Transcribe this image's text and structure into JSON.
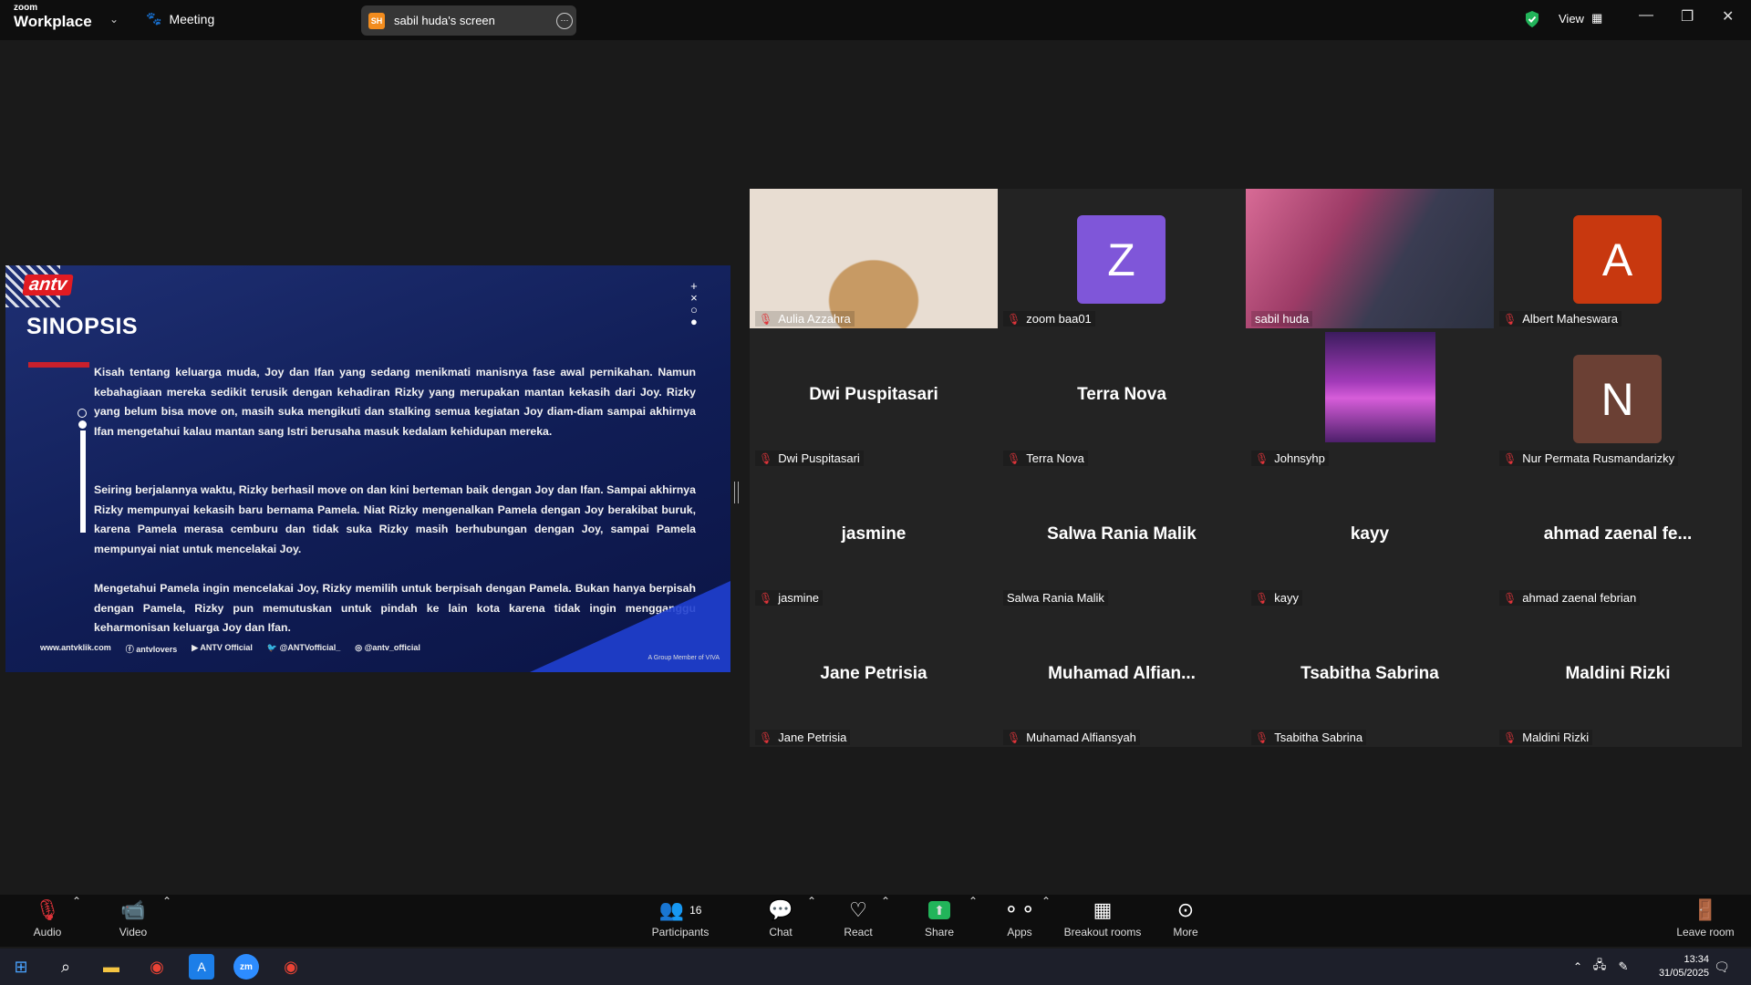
{
  "app": {
    "logo_top": "zoom",
    "logo_bottom": "Workplace",
    "meeting_label": "Meeting",
    "screen_badge": "SH",
    "screen_title": "sabil huda's screen",
    "view_label": "View"
  },
  "shared_screen": {
    "brand": "antv",
    "heading": "SINOPSIS",
    "paragraphs": [
      "Kisah tentang keluarga muda, Joy dan Ifan yang sedang menikmati manisnya fase awal pernikahan. Namun kebahagiaan mereka sedikit terusik dengan kehadiran Rizky yang merupakan mantan kekasih dari Joy. Rizky yang belum bisa move on, masih suka mengikuti dan stalking semua kegiatan Joy diam-diam sampai akhirnya Ifan mengetahui kalau mantan sang Istri berusaha masuk kedalam kehidupan mereka.",
      "Seiring berjalannya waktu, Rizky berhasil move on dan kini berteman baik dengan Joy dan Ifan. Sampai akhirnya Rizky mempunyai kekasih baru bernama Pamela. Niat Rizky mengenalkan Pamela dengan Joy berakibat buruk, karena Pamela merasa cemburu dan tidak suka Rizky masih berhubungan dengan Joy, sampai Pamela mempunyai niat untuk mencelakai Joy.",
      "Mengetahui Pamela ingin mencelakai Joy, Rizky memilih untuk berpisah dengan Pamela. Bukan hanya berpisah dengan Pamela, Rizky pun memutuskan untuk pindah ke lain kota karena tidak ingin mengganggu keharmonisan keluarga Joy dan Ifan."
    ],
    "footer": {
      "website": "www.antvklik.com",
      "facebook": "antvlovers",
      "youtube": "ANTV Official",
      "twitter": "@ANTVofficial_",
      "instagram": "@antv_official"
    },
    "group_text": "A Group Member of VIVA"
  },
  "participants": [
    {
      "tile_name": "Aulia Azzahra",
      "center": "",
      "avatar": "",
      "avatar_color": "",
      "kind": "photo1",
      "muted": true
    },
    {
      "tile_name": "zoom baa01",
      "center": "",
      "avatar": "Z",
      "avatar_color": "#7f56d9",
      "kind": "avatar",
      "muted": true
    },
    {
      "tile_name": "sabil huda",
      "center": "",
      "avatar": "",
      "avatar_color": "",
      "kind": "photo3",
      "muted": false,
      "active": true
    },
    {
      "tile_name": "Albert Maheswara",
      "center": "",
      "avatar": "A",
      "avatar_color": "#c8380f",
      "kind": "avatar",
      "muted": true
    },
    {
      "tile_name": "Dwi Puspitasari",
      "center": "Dwi Puspitasari",
      "avatar": "",
      "avatar_color": "",
      "kind": "text",
      "muted": true
    },
    {
      "tile_name": "Terra Nova",
      "center": "Terra Nova",
      "avatar": "",
      "avatar_color": "",
      "kind": "text",
      "muted": true
    },
    {
      "tile_name": "Johnsyhp",
      "center": "",
      "avatar": "",
      "avatar_color": "",
      "kind": "city",
      "muted": true
    },
    {
      "tile_name": "Nur Permata Rusmandarizky",
      "center": "",
      "avatar": "N",
      "avatar_color": "#6b4034",
      "kind": "avatar",
      "muted": true
    },
    {
      "tile_name": "jasmine",
      "center": "jasmine",
      "avatar": "",
      "avatar_color": "",
      "kind": "text",
      "muted": true
    },
    {
      "tile_name": "Salwa Rania Malik",
      "center": "Salwa Rania Malik",
      "avatar": "",
      "avatar_color": "",
      "kind": "text",
      "muted": false
    },
    {
      "tile_name": "kayy",
      "center": "kayy",
      "avatar": "",
      "avatar_color": "",
      "kind": "text",
      "muted": true
    },
    {
      "tile_name": "ahmad zaenal febrian",
      "center": "ahmad zaenal fe...",
      "avatar": "",
      "avatar_color": "",
      "kind": "text",
      "muted": true
    },
    {
      "tile_name": "Jane Petrisia",
      "center": "Jane Petrisia",
      "avatar": "",
      "avatar_color": "",
      "kind": "text",
      "muted": true
    },
    {
      "tile_name": "Muhamad Alfiansyah",
      "center": "Muhamad  Alfian...",
      "avatar": "",
      "avatar_color": "",
      "kind": "text",
      "muted": true
    },
    {
      "tile_name": "Tsabitha Sabrina",
      "center": "Tsabitha Sabrina",
      "avatar": "",
      "avatar_color": "",
      "kind": "text",
      "muted": true
    },
    {
      "tile_name": "Maldini Rizki",
      "center": "Maldini Rizki",
      "avatar": "",
      "avatar_color": "",
      "kind": "text",
      "muted": true
    }
  ],
  "toolbar": {
    "audio": "Audio",
    "video": "Video",
    "participants": "Participants",
    "participant_count": "16",
    "chat": "Chat",
    "react": "React",
    "share": "Share",
    "apps": "Apps",
    "breakout": "Breakout rooms",
    "more": "More",
    "leave": "Leave room"
  },
  "taskbar": {
    "time": "13:34",
    "date": "31/05/2025",
    "zoom_badge": "zm"
  },
  "colors": {
    "accent_green": "#22c88b",
    "muted_red": "#e0343a",
    "share_green": "#22b45a"
  }
}
